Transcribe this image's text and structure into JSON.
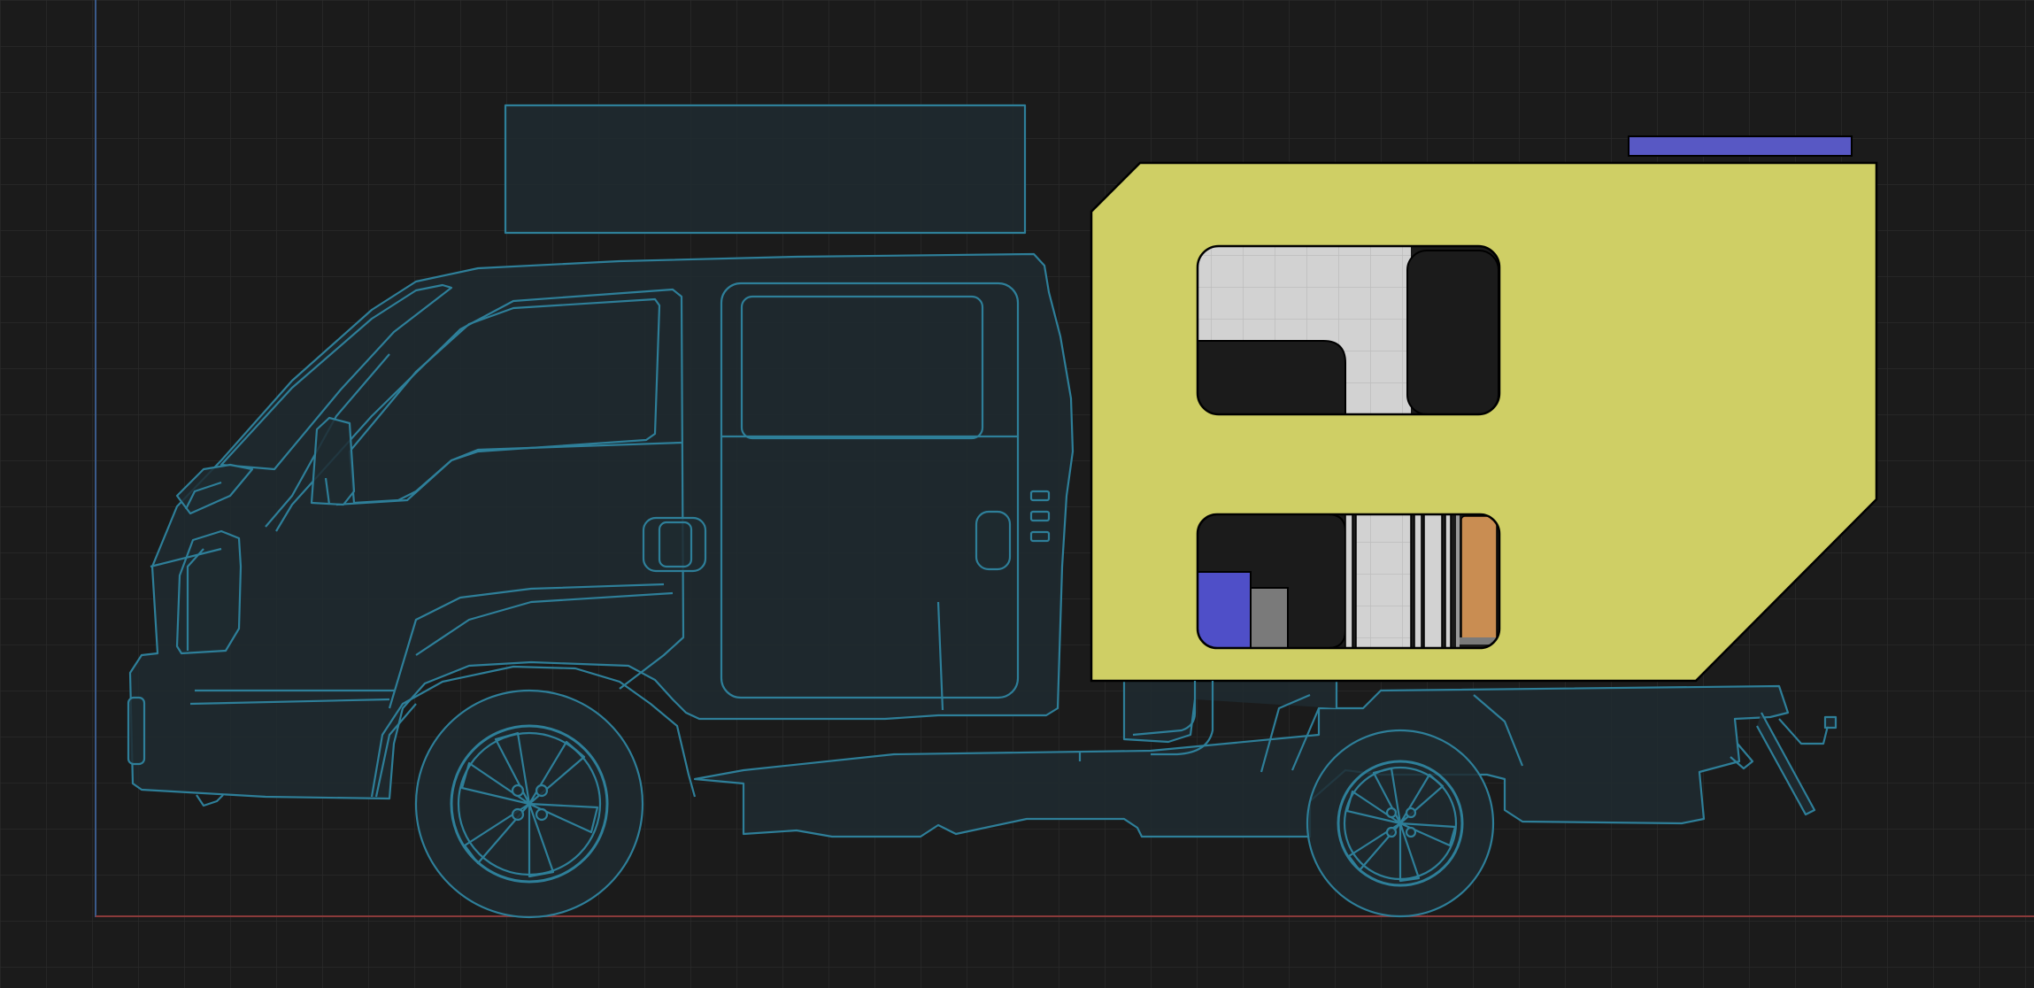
{
  "canvas": {
    "background": "#1b1b1b",
    "grid_color": "#2a2a2a",
    "axis_vertical_color": "#3a5a8a",
    "axis_horizontal_color": "#8a3a3a"
  },
  "truck": {
    "outline_color": "#2e7f99",
    "fill_color": "#1e2a30",
    "roof_panel_color": "#1f2a30"
  },
  "camper": {
    "shell_color": "#cfcf65",
    "shell_stroke": "#000000",
    "roof_vent_color": "#5858c4",
    "window_color": "#1b1b1b",
    "tile_color": "#d2d2d2",
    "blue_block_color": "#4f4fc8",
    "gray_block_color": "#7a7a7a",
    "wood_panel_color": "#c98d52"
  }
}
